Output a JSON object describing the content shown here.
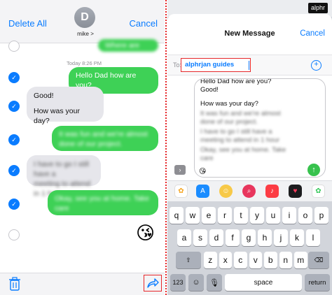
{
  "left": {
    "delete_all": "Delete All",
    "cancel": "Cancel",
    "avatar_initial": "D",
    "contact_name": "mike >",
    "top_partial": "Where are you",
    "timestamp": "Today 8:26 PM",
    "messages": [
      {
        "side": "out",
        "text": "Hello Dad how are you?",
        "selected": true,
        "blurred": false
      },
      {
        "side": "in",
        "lines": [
          "Good!",
          "How was your day?"
        ],
        "selected": true,
        "blurred": false
      },
      {
        "side": "out",
        "lines": [
          "It was fun and we're almost",
          "done of our project."
        ],
        "selected": true,
        "blurred": true
      },
      {
        "side": "in",
        "lines": [
          "I have to go I still have a",
          "meeting to attend in 1 hour"
        ],
        "selected": true,
        "blurred": true
      },
      {
        "side": "out",
        "lines": [
          "Okay, see you at home. Take",
          "care"
        ],
        "selected": true,
        "blurred": true
      },
      {
        "side": "out",
        "text": "😘",
        "selected": false,
        "blurred": false
      }
    ],
    "icons": [
      "trash-icon",
      "share-icon"
    ]
  },
  "right": {
    "title": "New Message",
    "cancel": "Cancel",
    "to_label": "To:",
    "recipient": "alphrjan guides",
    "compose_lines": [
      "Hello Dad how are you?",
      "Good!",
      "How was your day?"
    ],
    "compose_blurred": [
      "It was fun and we're almost",
      "done of our project.",
      "I have to go I still have a",
      "meeting to attend in 1 hour",
      "Okay, see you at home. Take",
      "care"
    ],
    "watermark": "alphr",
    "keyboard": {
      "row1": [
        "q",
        "w",
        "e",
        "r",
        "t",
        "y",
        "u",
        "i",
        "o",
        "p"
      ],
      "row2": [
        "a",
        "s",
        "d",
        "f",
        "g",
        "h",
        "j",
        "k",
        "l"
      ],
      "row3": [
        "z",
        "x",
        "c",
        "v",
        "b",
        "n",
        "m"
      ],
      "num_key": "123",
      "space_key": "space",
      "return_key": "return"
    },
    "apps": [
      "photos-app-icon",
      "app-store-icon",
      "memoji-icon",
      "search-images-icon",
      "music-icon",
      "heart-app-icon",
      "photos-alt-icon"
    ]
  }
}
